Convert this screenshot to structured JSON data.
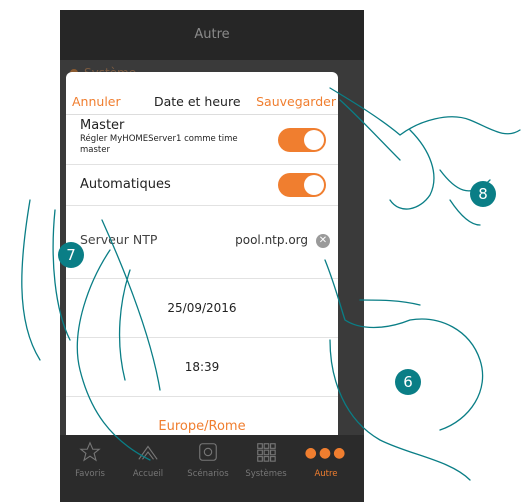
{
  "app": {
    "title": "Autre",
    "background_item": "Système"
  },
  "modal": {
    "cancel_label": "Annuler",
    "title": "Date et heure",
    "save_label": "Sauvegarder",
    "master": {
      "label": "Master",
      "description": "Régler MyHOMEServer1 comme time master",
      "on": true
    },
    "auto": {
      "label": "Automatiques",
      "on": true
    },
    "ntp": {
      "label": "Serveur NTP",
      "value": "pool.ntp.org",
      "clear_icon": "clear-icon"
    },
    "date": "25/09/2016",
    "time": "18:39",
    "timezone": "Europe/Rome"
  },
  "tabs": [
    {
      "label": "Favoris",
      "icon": "star-icon"
    },
    {
      "label": "Accueil",
      "icon": "home-icon"
    },
    {
      "label": "Scénarios",
      "icon": "scenario-icon"
    },
    {
      "label": "Systèmes",
      "icon": "grid-icon"
    },
    {
      "label": "Autre",
      "icon": "more-icon",
      "active": true
    }
  ],
  "callouts": [
    "6",
    "7",
    "8"
  ],
  "colors": {
    "accent": "#f07e2f",
    "badge": "#0a7e86"
  }
}
